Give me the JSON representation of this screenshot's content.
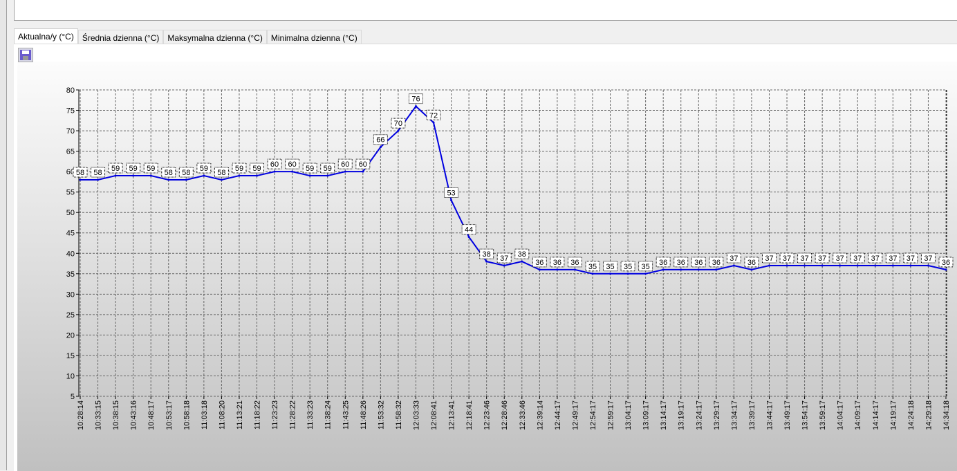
{
  "tabs": [
    "Aktualna/y (°C)",
    "Średnia dzienna (°C)",
    "Maksymalna dzienna (°C)",
    "Minimalna dzienna (°C)"
  ],
  "active_tab": 0,
  "toolbar": {
    "save_icon": "floppy-disk-icon"
  },
  "chart_data": {
    "type": "line",
    "title": "",
    "xlabel": "",
    "ylabel": "",
    "ylim": [
      5,
      80
    ],
    "yticks": [
      5,
      10,
      15,
      20,
      25,
      30,
      35,
      40,
      45,
      50,
      55,
      60,
      65,
      70,
      75,
      80
    ],
    "grid": true,
    "series_color": "#0000e0",
    "x": [
      "10:28:14",
      "10:33:15",
      "10:38:15",
      "10:43:16",
      "10:48:17",
      "10:53:17",
      "10:58:18",
      "11:03:18",
      "11:08:20",
      "11:13:21",
      "11:18:22",
      "11:23:23",
      "11:28:22",
      "11:33:23",
      "11:38:24",
      "11:43:25",
      "11:48:26",
      "11:53:32",
      "11:58:32",
      "12:03:33",
      "12:08:41",
      "12:13:41",
      "12:18:41",
      "12:23:46",
      "12:28:46",
      "12:33:46",
      "12:39:14",
      "12:44:17",
      "12:49:17",
      "12:54:17",
      "12:59:17",
      "13:04:17",
      "13:09:17",
      "13:14:17",
      "13:19:17",
      "13:24:17",
      "13:29:17",
      "13:34:17",
      "13:39:17",
      "13:44:17",
      "13:49:17",
      "13:54:17",
      "13:59:17",
      "14:04:17",
      "14:09:17",
      "14:14:17",
      "14:19:17",
      "14:24:18",
      "14:29:18",
      "14:34:18"
    ],
    "values": [
      58,
      58,
      59,
      59,
      59,
      58,
      58,
      59,
      58,
      59,
      59,
      60,
      60,
      59,
      59,
      60,
      60,
      66,
      70,
      76,
      72,
      53,
      44,
      38,
      37,
      38,
      36,
      36,
      36,
      35,
      35,
      35,
      35,
      36,
      36,
      36,
      36,
      37,
      36,
      37,
      37,
      37,
      37,
      37,
      37,
      37,
      37,
      37,
      37,
      36
    ]
  }
}
